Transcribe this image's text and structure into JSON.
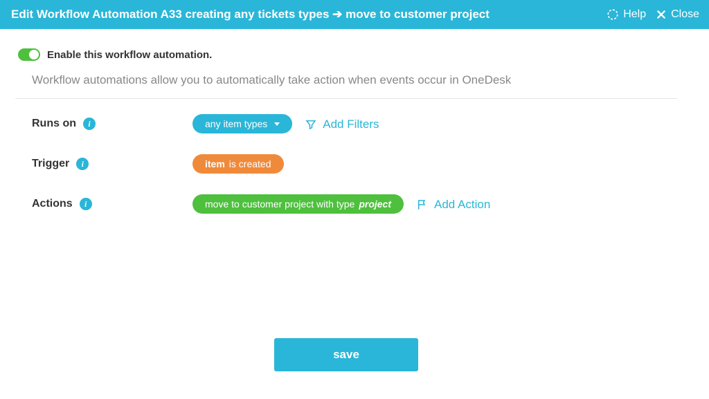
{
  "header": {
    "title": "Edit Workflow Automation A33 creating any tickets types ➔ move to customer project",
    "help": "Help",
    "close": "Close"
  },
  "enable": {
    "label": "Enable this workflow automation."
  },
  "description": "Workflow automations allow you to automatically take action when events occur in OneDesk",
  "runsOn": {
    "label": "Runs on",
    "pill": "any item types",
    "addFilters": "Add Filters"
  },
  "trigger": {
    "label": "Trigger",
    "pillBold": "item",
    "pillRest": " is created"
  },
  "actions": {
    "label": "Actions",
    "pillPrefix": "move to customer project with type ",
    "pillEm": "project",
    "addAction": "Add Action"
  },
  "save": "save"
}
